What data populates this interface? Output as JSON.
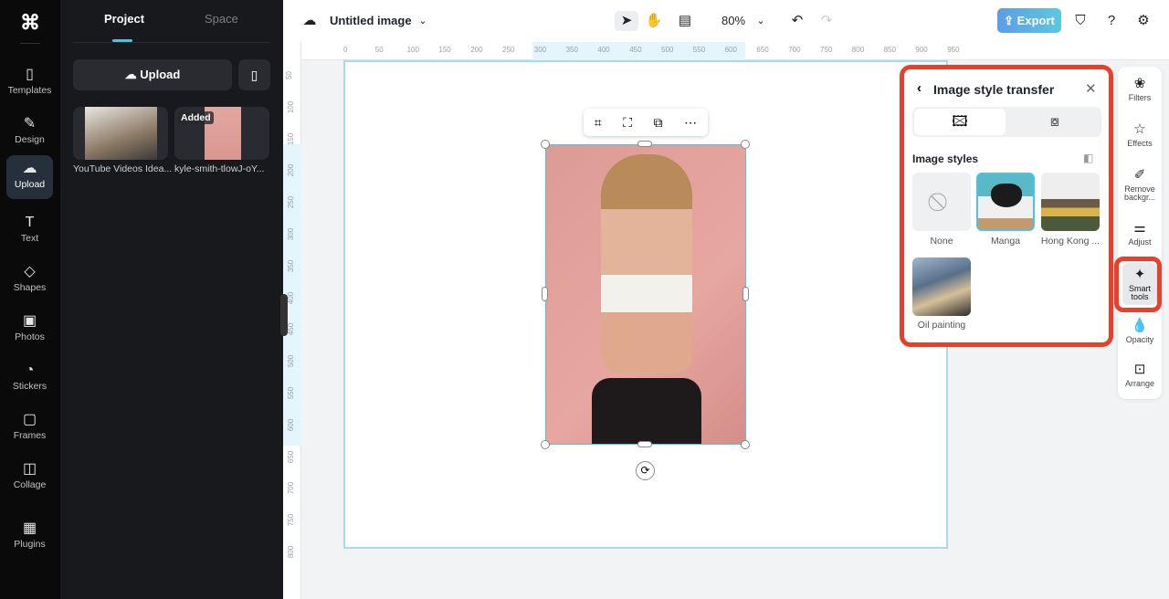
{
  "rail": {
    "items": [
      {
        "label": "Templates",
        "icon": "▯"
      },
      {
        "label": "Design",
        "icon": "✎"
      },
      {
        "label": "Upload",
        "icon": "☁"
      },
      {
        "label": "Text",
        "icon": "T"
      },
      {
        "label": "Shapes",
        "icon": "◇"
      },
      {
        "label": "Photos",
        "icon": "▣"
      },
      {
        "label": "Stickers",
        "icon": "◔"
      },
      {
        "label": "Frames",
        "icon": "▢"
      },
      {
        "label": "Collage",
        "icon": "◫"
      },
      {
        "label": "Plugins",
        "icon": "▦"
      }
    ]
  },
  "panel": {
    "tabs": [
      "Project",
      "Space"
    ],
    "upload_label": "Upload",
    "assets": [
      {
        "name": "YouTube Videos Idea..."
      },
      {
        "name": "kyle-smith-tlowJ-oY...",
        "badge": "Added"
      }
    ]
  },
  "header": {
    "title": "Untitled image",
    "zoom": "80%",
    "export_label": "Export"
  },
  "ruler": {
    "h": [
      "0",
      "50",
      "100",
      "150",
      "200",
      "250",
      "300",
      "350",
      "400",
      "450",
      "500",
      "550",
      "600",
      "650",
      "700",
      "750",
      "800",
      "850",
      "900",
      "950"
    ],
    "v": [
      "50",
      "100",
      "150",
      "200",
      "250",
      "300",
      "350",
      "400",
      "450",
      "500",
      "550",
      "600",
      "650",
      "700",
      "750",
      "800"
    ]
  },
  "style_panel": {
    "title": "Image style transfer",
    "section": "Image styles",
    "styles": [
      {
        "name": "None"
      },
      {
        "name": "Manga",
        "selected": true
      },
      {
        "name": "Hong Kong ..."
      },
      {
        "name": "Oil painting"
      }
    ]
  },
  "right_tools": [
    {
      "label": "Filters",
      "icon": "❀"
    },
    {
      "label": "Effects",
      "icon": "☆"
    },
    {
      "label": "Remove backgr...",
      "icon": "✐"
    },
    {
      "label": "Adjust",
      "icon": "⚌"
    },
    {
      "label": "Smart tools",
      "icon": "✦"
    },
    {
      "label": "Opacity",
      "icon": "💧"
    },
    {
      "label": "Arrange",
      "icon": "⊡"
    }
  ]
}
